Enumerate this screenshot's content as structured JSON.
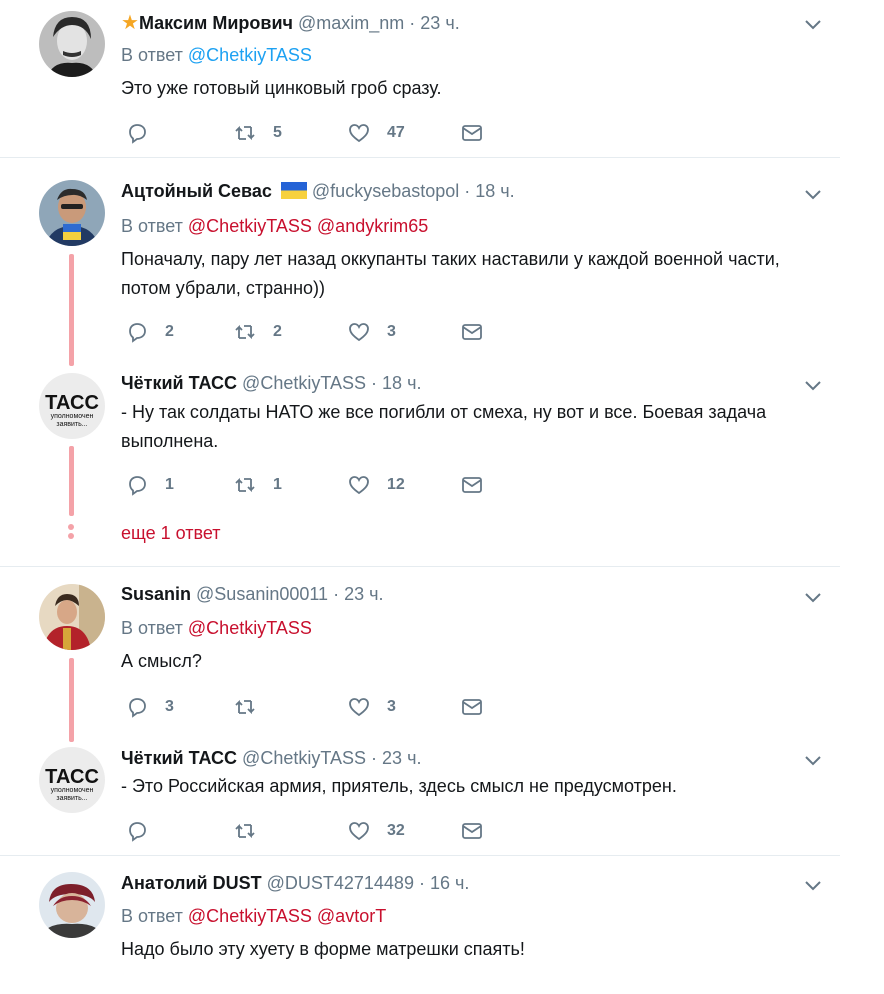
{
  "tweets": [
    {
      "name": "Максим Мирович",
      "handle": "@maxim_nm",
      "time": "· 23 ч.",
      "reply_prefix": "В ответ",
      "reply_to": [
        "@ChetkiyTASS"
      ],
      "text": "Это уже готовый цинковый гроб сразу.",
      "replies": "",
      "retweets": "5",
      "likes": "47"
    },
    {
      "name": "Ацтойный Севас",
      "handle": "@fuckysebastopol",
      "time": "· 18 ч.",
      "reply_prefix": "В ответ",
      "reply_to": [
        "@ChetkiyTASS",
        "@andykrim65"
      ],
      "text": "Поначалу,  пару лет назад оккупанты таких наставили у каждой военной части,  потом убрали,  странно))",
      "replies": "2",
      "retweets": "2",
      "likes": "3"
    },
    {
      "name": "Чёткий ТАСС",
      "handle": "@ChetkiyTASS",
      "time": "· 18 ч.",
      "text": "- Ну так солдаты НАТО же все погибли от смеха, ну вот и все. Боевая задача выполнена.",
      "replies": "1",
      "retweets": "1",
      "likes": "12"
    },
    {
      "name": "Susanin",
      "handle": "@Susanin00011",
      "time": "· 23 ч.",
      "reply_prefix": "В ответ",
      "reply_to": [
        "@ChetkiyTASS"
      ],
      "text": "А смысл?",
      "replies": "3",
      "retweets": "",
      "likes": "3"
    },
    {
      "name": "Чёткий ТАСС",
      "handle": "@ChetkiyTASS",
      "time": "· 23 ч.",
      "text": "- Это Российская армия, приятель, здесь смысл не предусмотрен.",
      "replies": "",
      "retweets": "",
      "likes": "32"
    },
    {
      "name": "Анатолий DUST",
      "handle": "@DUST42714489",
      "time": "· 16 ч.",
      "reply_prefix": "В ответ",
      "reply_to": [
        "@ChetkiyTASS",
        "@avtorT"
      ],
      "text": "Надо было эту хуету в форме матрешки спаять!"
    }
  ],
  "more_replies": "еще 1 ответ",
  "tass_avatar": {
    "big": "ТАСС",
    "line1": "уполномочен",
    "line2": "заявить..."
  },
  "colors": {
    "link_blue": "#1da1f2",
    "link_red": "#c8102e",
    "thread": "#f4a2a8",
    "muted": "#657786"
  }
}
